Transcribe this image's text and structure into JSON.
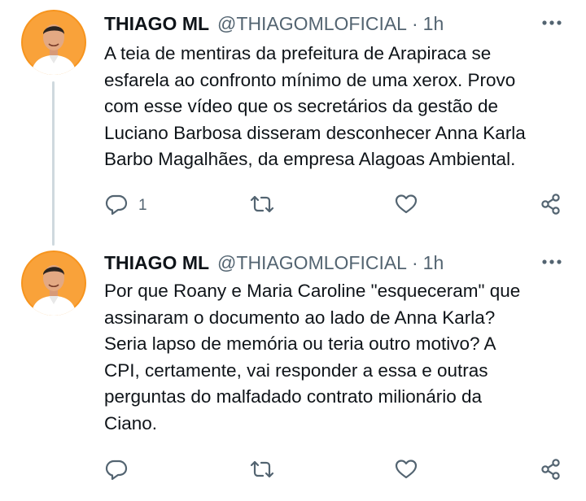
{
  "tweets": [
    {
      "author_name": "THIAGO ML",
      "handle": "@THIAGOMLOFICIAL",
      "separator": "·",
      "time": "1h",
      "text_lines": [
        "A teia de mentiras da prefeitura de Arapiraca se",
        "esfarela ao confronto mínimo de uma xerox. Provo",
        "com esse vídeo que os secretários da gestão de",
        "Luciano Barbosa disseram desconhecer Anna Karla",
        "Barbo Magalhães, da empresa Alagoas Ambiental."
      ],
      "reply_count": "1",
      "icons": {
        "more": "more-horizontal-icon",
        "reply": "reply-icon",
        "retweet": "retweet-icon",
        "like": "heart-icon",
        "share": "share-icon"
      }
    },
    {
      "author_name": "THIAGO ML",
      "handle": "@THIAGOMLOFICIAL",
      "separator": "·",
      "time": "1h",
      "text_lines": [
        "Por que Roany e Maria Caroline \"esqueceram\" que",
        "assinaram o documento ao lado de Anna Karla?",
        "Seria lapso de memória ou teria outro motivo?  A",
        "CPI, certamente, vai responder a essa e outras",
        "perguntas do malfadado contrato milionário da",
        "Ciano."
      ],
      "icons": {
        "more": "more-horizontal-icon",
        "reply": "reply-icon",
        "retweet": "retweet-icon",
        "like": "heart-icon",
        "share": "share-icon"
      }
    }
  ],
  "colors": {
    "avatar_background": "#f7941d",
    "secondary_text": "#536471",
    "thread_line": "#cfd9de"
  }
}
